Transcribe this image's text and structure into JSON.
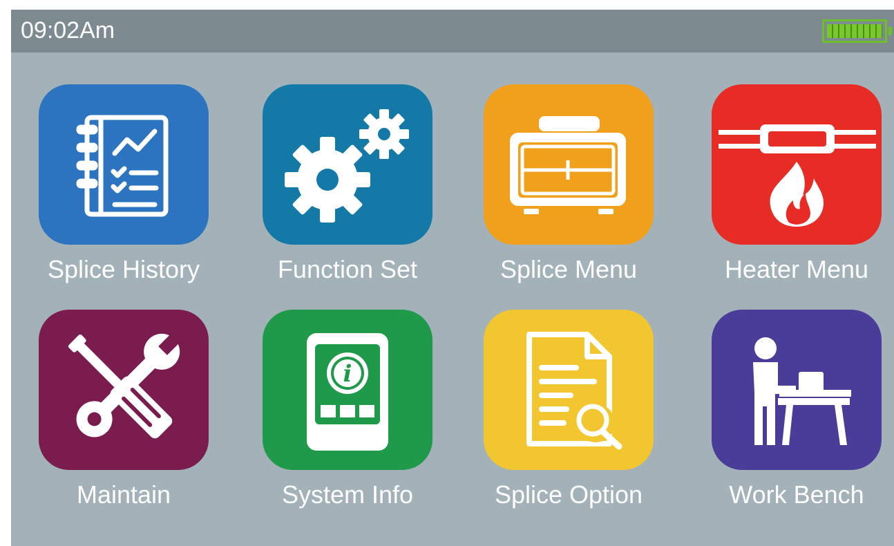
{
  "status_bar": {
    "time": "09:02Am",
    "battery_level": 1.0,
    "battery_color": "#6fbf2a"
  },
  "menu": {
    "tiles": [
      {
        "label": "Splice History",
        "icon": "notebook-chart-icon",
        "color": "#2c74c0"
      },
      {
        "label": "Function Set",
        "icon": "gears-icon",
        "color": "#1579a8"
      },
      {
        "label": "Splice Menu",
        "icon": "splicer-machine-icon",
        "color": "#f1a01c"
      },
      {
        "label": "Heater Menu",
        "icon": "heater-flame-icon",
        "color": "#e72b25"
      },
      {
        "label": "Maintain",
        "icon": "wrench-screwdriver-icon",
        "color": "#7b1c4e"
      },
      {
        "label": "System Info",
        "icon": "device-info-icon",
        "color": "#1f9a4a"
      },
      {
        "label": "Splice Option",
        "icon": "document-search-icon",
        "color": "#f2c62f"
      },
      {
        "label": "Work Bench",
        "icon": "workbench-person-icon",
        "color": "#4a3d9a"
      }
    ]
  }
}
